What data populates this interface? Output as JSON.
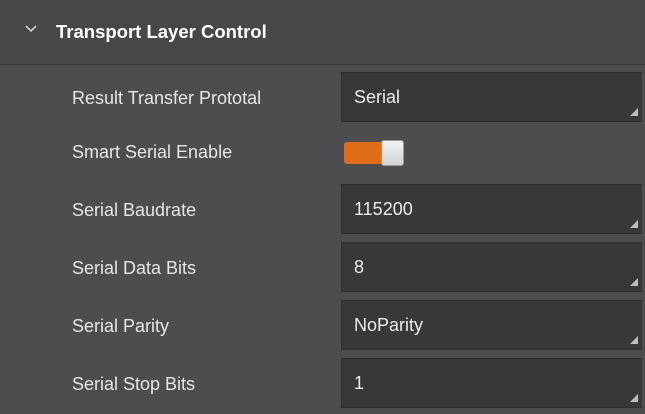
{
  "section": {
    "title": "Transport Layer Control",
    "expanded": true,
    "chevron_icon": "chevron-down-icon"
  },
  "rows": [
    {
      "label": "Result Transfer Prototal",
      "type": "dropdown",
      "value": "Serial"
    },
    {
      "label": "Smart Serial Enable",
      "type": "toggle",
      "value": "on"
    },
    {
      "label": "Serial Baudrate",
      "type": "dropdown",
      "value": "115200"
    },
    {
      "label": "Serial Data Bits",
      "type": "dropdown",
      "value": "8"
    },
    {
      "label": "Serial Parity",
      "type": "dropdown",
      "value": "NoParity"
    },
    {
      "label": "Serial Stop Bits",
      "type": "dropdown",
      "value": "1"
    }
  ],
  "colors": {
    "panel_bg": "#4d4d4f",
    "field_bg": "#38383a",
    "toggle_on": "#e06c19"
  }
}
